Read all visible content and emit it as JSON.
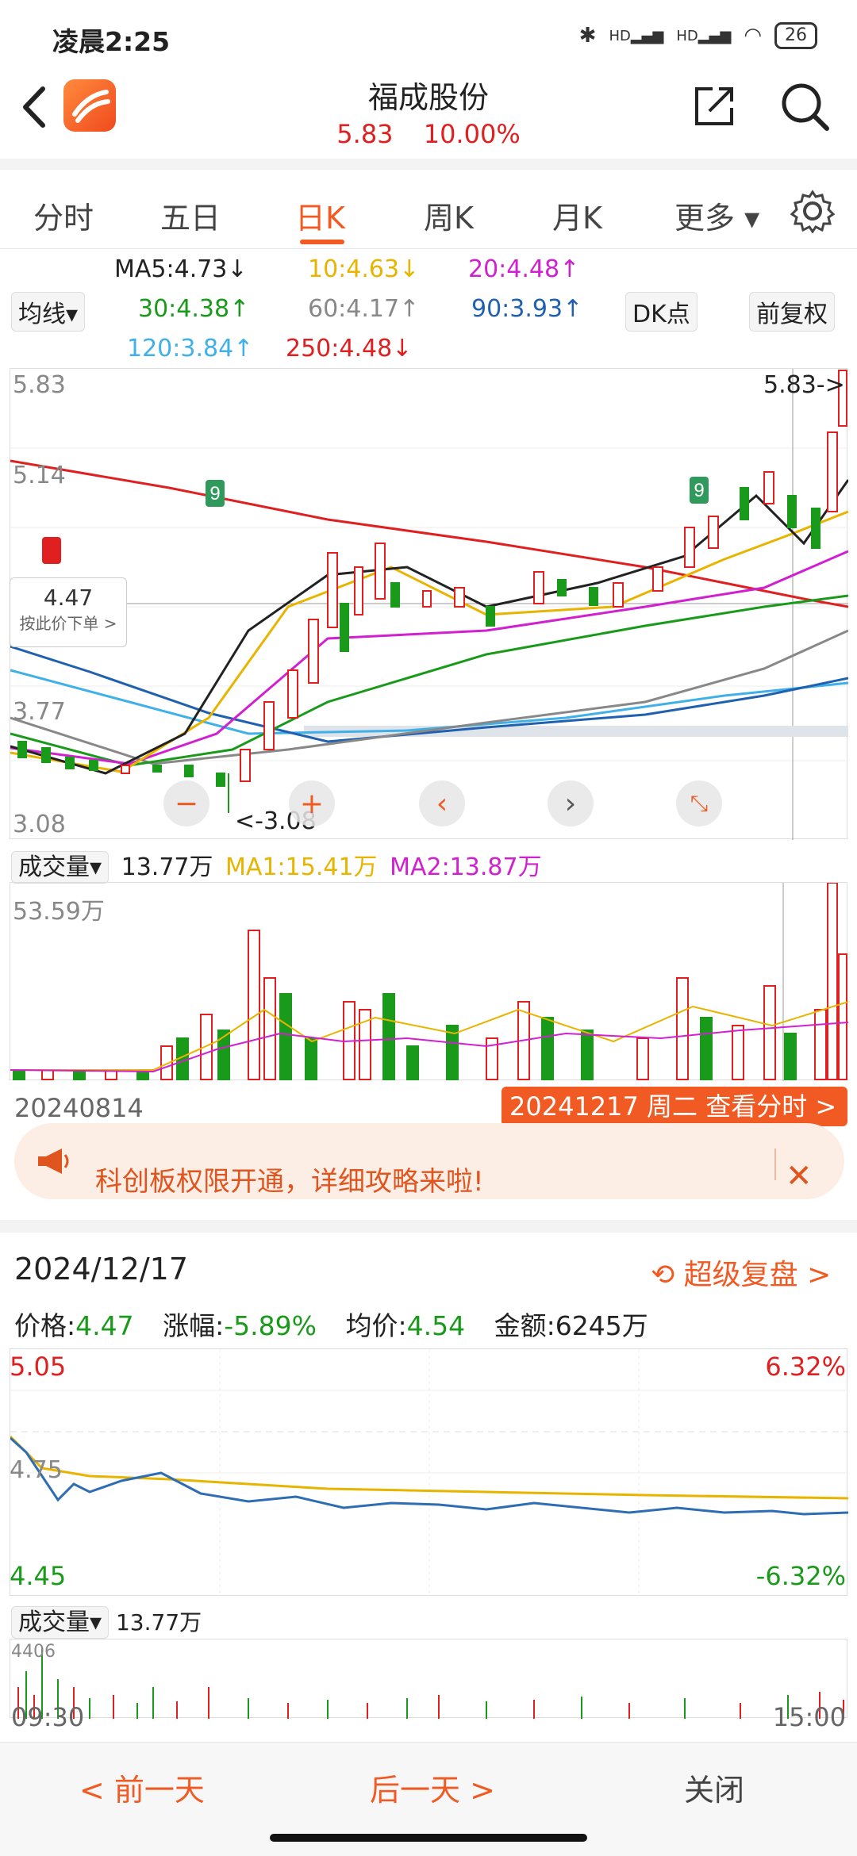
{
  "status_bar": {
    "time": "凌晨2:25",
    "battery": "26",
    "network_labels": [
      "HD",
      "HD"
    ]
  },
  "header": {
    "title": "福成股份",
    "price": "5.83",
    "change_pct": "10.00%"
  },
  "tabs": [
    {
      "label": "分时"
    },
    {
      "label": "五日"
    },
    {
      "label": "日K",
      "active": true
    },
    {
      "label": "周K"
    },
    {
      "label": "月K"
    },
    {
      "label": "更多 ▾"
    }
  ],
  "ma_legend": {
    "ma5": "MA5:4.73↓",
    "ma10": "10:4.63↓",
    "ma20": "20:4.48↑",
    "ma30": "30:4.38↑",
    "ma60": "60:4.17↑",
    "ma90": "90:3.93↑",
    "ma120": "120:3.84↑",
    "ma250": "250:4.48↓"
  },
  "controls": {
    "ma_select": "均线▾",
    "dk_button": "DK点",
    "adjust": "前复权"
  },
  "kline": {
    "price_levels": [
      "5.83",
      "5.14",
      "3.77",
      "3.08"
    ],
    "hover_price": "4.47",
    "hover_hint": "按此价下单 >",
    "high_marker": "5.83->",
    "low_marker": "<-3.08"
  },
  "volume": {
    "selector": "成交量▾",
    "value": "13.77万",
    "ma1": "MA1:15.41万",
    "ma2": "MA2:13.87万",
    "max": "53.59万"
  },
  "date_axis": {
    "start": "20240814",
    "selected": "20241217 周二 查看分时 >"
  },
  "notice": {
    "text": "科创板权限开通，详细攻略来啦!"
  },
  "detail": {
    "date": "2024/12/17",
    "replay": "超级复盘 >",
    "price_label": "价格:",
    "price": "4.47",
    "change_label": "涨幅:",
    "change": "-5.89%",
    "avg_label": "均价:",
    "avg": "4.54",
    "amount_label": "金额:",
    "amount": "6245万"
  },
  "intraday": {
    "top_price": "5.05",
    "top_pct": "6.32%",
    "mid_price": "4.75",
    "bottom_price": "4.45",
    "bottom_pct": "-6.32%",
    "vol_selector": "成交量▾",
    "vol_value": "13.77万",
    "vol_max": "4406",
    "time_start": "09:30",
    "time_end": "15:00"
  },
  "bottom_nav": {
    "prev": "< 前一天",
    "next": "后一天 >",
    "close": "关闭"
  },
  "colors": {
    "accent": "#f15a22",
    "up": "#e02020",
    "down": "#1a9a1a"
  }
}
